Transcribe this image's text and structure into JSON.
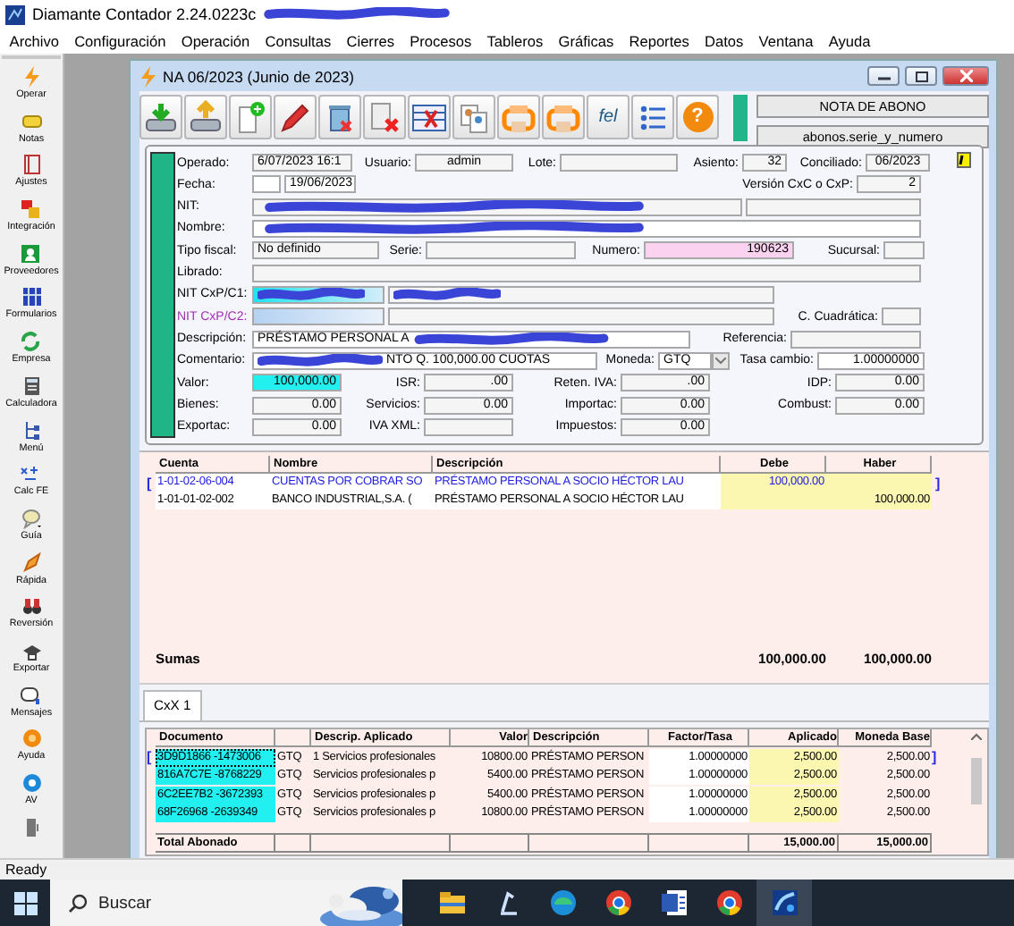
{
  "app": {
    "title": "Diamante Contador 2.24.0223c",
    "title_redacted": true
  },
  "menu": [
    "Archivo",
    "Configuración",
    "Operación",
    "Consultas",
    "Cierres",
    "Procesos",
    "Tableros",
    "Gráficas",
    "Reportes",
    "Datos",
    "Ventana",
    "Ayuda"
  ],
  "sidebar": {
    "items": [
      "Operar",
      "Notas",
      "Ajustes",
      "Integración",
      "Proveedores",
      "Formularios",
      "Empresa",
      "Calculadora",
      "Menú",
      "Calc FE",
      "Guía",
      "Rápida",
      "Reversión",
      "Exportar",
      "Mensajes",
      "Ayuda",
      "AV"
    ]
  },
  "document": {
    "title": "NA 06/2023 (Junio de 2023)",
    "fel_button": "fel",
    "help_button": "?",
    "document_type": "NOTA DE ABONO",
    "series_field": "abonos.serie_y_numero"
  },
  "form": {
    "rows": [
      {
        "items": [
          {
            "kind": "label",
            "text": "Operado:"
          },
          {
            "kind": "field",
            "value": "6/07/2023 16:1"
          },
          {
            "kind": "label",
            "text": "Usuario:"
          },
          {
            "kind": "field",
            "value": "admin"
          },
          {
            "kind": "label",
            "text": "Lote:"
          },
          {
            "kind": "field"
          },
          {
            "kind": "label",
            "text": "Asiento:"
          },
          {
            "kind": "field",
            "value": "32"
          },
          {
            "kind": "label",
            "text": "Conciliado:"
          },
          {
            "kind": "field",
            "value": "06/2023"
          }
        ]
      },
      {
        "items": [
          {
            "kind": "label",
            "text": "Fecha:"
          },
          {
            "kind": "whitefield"
          },
          {
            "kind": "whitefield",
            "value": "19/06/2023"
          },
          {
            "kind": "label",
            "text": "Versión CxC o CxP:"
          },
          {
            "kind": "field",
            "value": "2"
          }
        ]
      },
      {
        "items": [
          {
            "kind": "label",
            "text": "NIT:"
          },
          {
            "kind": "field",
            "redacted": true
          },
          {
            "kind": "field"
          }
        ]
      },
      {
        "items": [
          {
            "kind": "label",
            "text": "Nombre:"
          },
          {
            "kind": "whitefield",
            "redacted": true
          }
        ]
      },
      {
        "items": [
          {
            "kind": "label",
            "text": "Tipo fiscal:"
          },
          {
            "kind": "field",
            "value": "No definido"
          },
          {
            "kind": "label",
            "text": "Serie:"
          },
          {
            "kind": "field"
          },
          {
            "kind": "label",
            "text": "Numero:"
          },
          {
            "kind": "pinkfield",
            "value": "190623"
          },
          {
            "kind": "label",
            "text": "Sucursal:"
          },
          {
            "kind": "field"
          }
        ]
      },
      {
        "items": [
          {
            "kind": "label",
            "text": "Librado:"
          },
          {
            "kind": "field"
          }
        ]
      },
      {
        "items": [
          {
            "kind": "label",
            "text": "NIT CxP/C1:"
          },
          {
            "kind": "cyanfade",
            "redacted": true
          },
          {
            "kind": "field",
            "redacted": true
          }
        ]
      },
      {
        "items": [
          {
            "kind": "label",
            "text": "NIT CxP/C2:",
            "color": "#a030b0"
          },
          {
            "kind": "bluefade"
          },
          {
            "kind": "field"
          },
          {
            "kind": "label",
            "text": "C. Cuadrática:"
          },
          {
            "kind": "field"
          }
        ]
      },
      {
        "items": [
          {
            "kind": "label",
            "text": "Descripción:"
          },
          {
            "kind": "whitefield",
            "value": "PRÉSTAMO PERSONAL A",
            "redacted_after": true
          },
          {
            "kind": "label",
            "text": "Referencia:"
          },
          {
            "kind": "field"
          }
        ]
      },
      {
        "items": [
          {
            "kind": "label",
            "text": "Comentario:"
          },
          {
            "kind": "whitefield",
            "value": "NTO Q. 100,000.00 CUOTAS",
            "redacted": true
          },
          {
            "kind": "label",
            "text": "Moneda:"
          },
          {
            "kind": "select",
            "value": "GTQ"
          },
          {
            "kind": "label",
            "text": "Tasa cambio:"
          },
          {
            "kind": "whitefield",
            "value": "1.00000000"
          }
        ]
      },
      {
        "items": [
          {
            "kind": "label",
            "text": "Valor:"
          },
          {
            "kind": "cyanfield",
            "value": "100,000.00"
          },
          {
            "kind": "label",
            "text": "ISR:"
          },
          {
            "kind": "field",
            "value": ".00"
          },
          {
            "kind": "label",
            "text": "Reten. IVA:"
          },
          {
            "kind": "field",
            "value": ".00"
          },
          {
            "kind": "label",
            "text": "IDP:"
          },
          {
            "kind": "field",
            "value": "0.00"
          }
        ]
      },
      {
        "items": [
          {
            "kind": "label",
            "text": "Bienes:"
          },
          {
            "kind": "field",
            "value": "0.00"
          },
          {
            "kind": "label",
            "text": "Servicios:"
          },
          {
            "kind": "field",
            "value": "0.00"
          },
          {
            "kind": "label",
            "text": "Importac:"
          },
          {
            "kind": "field",
            "value": "0.00"
          },
          {
            "kind": "label",
            "text": "Combust:"
          },
          {
            "kind": "field",
            "value": "0.00"
          }
        ]
      },
      {
        "items": [
          {
            "kind": "label",
            "text": "Exportac:"
          },
          {
            "kind": "field",
            "value": "0.00"
          },
          {
            "kind": "label",
            "text": "IVA XML:"
          },
          {
            "kind": "field"
          },
          {
            "kind": "label",
            "text": "Impuestos:"
          },
          {
            "kind": "field",
            "value": "0.00"
          }
        ]
      }
    ]
  },
  "entries": {
    "columns": [
      "Cuenta",
      "Nombre",
      "Descripción",
      "Debe",
      "Haber"
    ],
    "selection_marks": [
      "[",
      "]"
    ],
    "rows": [
      {
        "selected": true,
        "cells": [
          "1-01-02-06-004",
          "CUENTAS POR COBRAR SO",
          "PRÉSTAMO PERSONAL A SOCIO HÉCTOR LAU",
          "100,000.00",
          ""
        ]
      },
      {
        "selected": false,
        "cells": [
          "1-01-01-02-002",
          "BANCO INDUSTRIAL,S.A. (",
          "PRÉSTAMO PERSONAL A SOCIO HÉCTOR LAU",
          "",
          "100,000.00"
        ]
      }
    ],
    "totals": {
      "label": "Sumas",
      "debe": "100,000.00",
      "haber": "100,000.00"
    }
  },
  "tabs": [
    {
      "label": "CxX 1",
      "selected": true
    }
  ],
  "applied": {
    "columns": [
      "Documento",
      "",
      "Descrip. Aplicado",
      "Valor",
      "Descripción",
      "Factor/Tasa",
      "Aplicado",
      "Moneda Base"
    ],
    "selection_marks": [
      "[",
      "]"
    ],
    "rows": [
      {
        "selected": true,
        "cells": [
          "3D9D1866 -1473006",
          "GTQ",
          "1 Servicios profesionales",
          "10800.00",
          "PRÉSTAMO PERSON",
          "1.00000000",
          "2,500.00",
          "2,500.00"
        ]
      },
      {
        "selected": false,
        "cells": [
          "816A7C7E -8768229",
          "GTQ",
          "Servicios profesionales p",
          "5400.00",
          "PRÉSTAMO PERSON",
          "1.00000000",
          "2,500.00",
          "2,500.00"
        ]
      },
      {
        "selected": false,
        "cells": [
          "6C2EE7B2 -3672393",
          "GTQ",
          "Servicios profesionales p",
          "5400.00",
          "PRÉSTAMO PERSON",
          "1.00000000",
          "2,500.00",
          "2,500.00"
        ]
      },
      {
        "selected": false,
        "cells": [
          "68F26968 -2639349",
          "GTQ",
          "Servicios profesionales p",
          "10800.00",
          "PRÉSTAMO PERSON",
          "1.00000000",
          "2,500.00",
          "2,500.00"
        ]
      }
    ],
    "totals": {
      "label": "Total Abonado",
      "aplicado": "15,000.00",
      "moneda_base": "15,000.00"
    }
  },
  "status_bar": "Ready",
  "taskbar": {
    "search_placeholder": "Buscar",
    "apps": [
      {
        "selected": false
      },
      {
        "selected": false
      },
      {
        "selected": false
      },
      {
        "selected": false
      },
      {
        "selected": false
      },
      {
        "selected": false
      },
      {
        "selected": true
      }
    ]
  }
}
